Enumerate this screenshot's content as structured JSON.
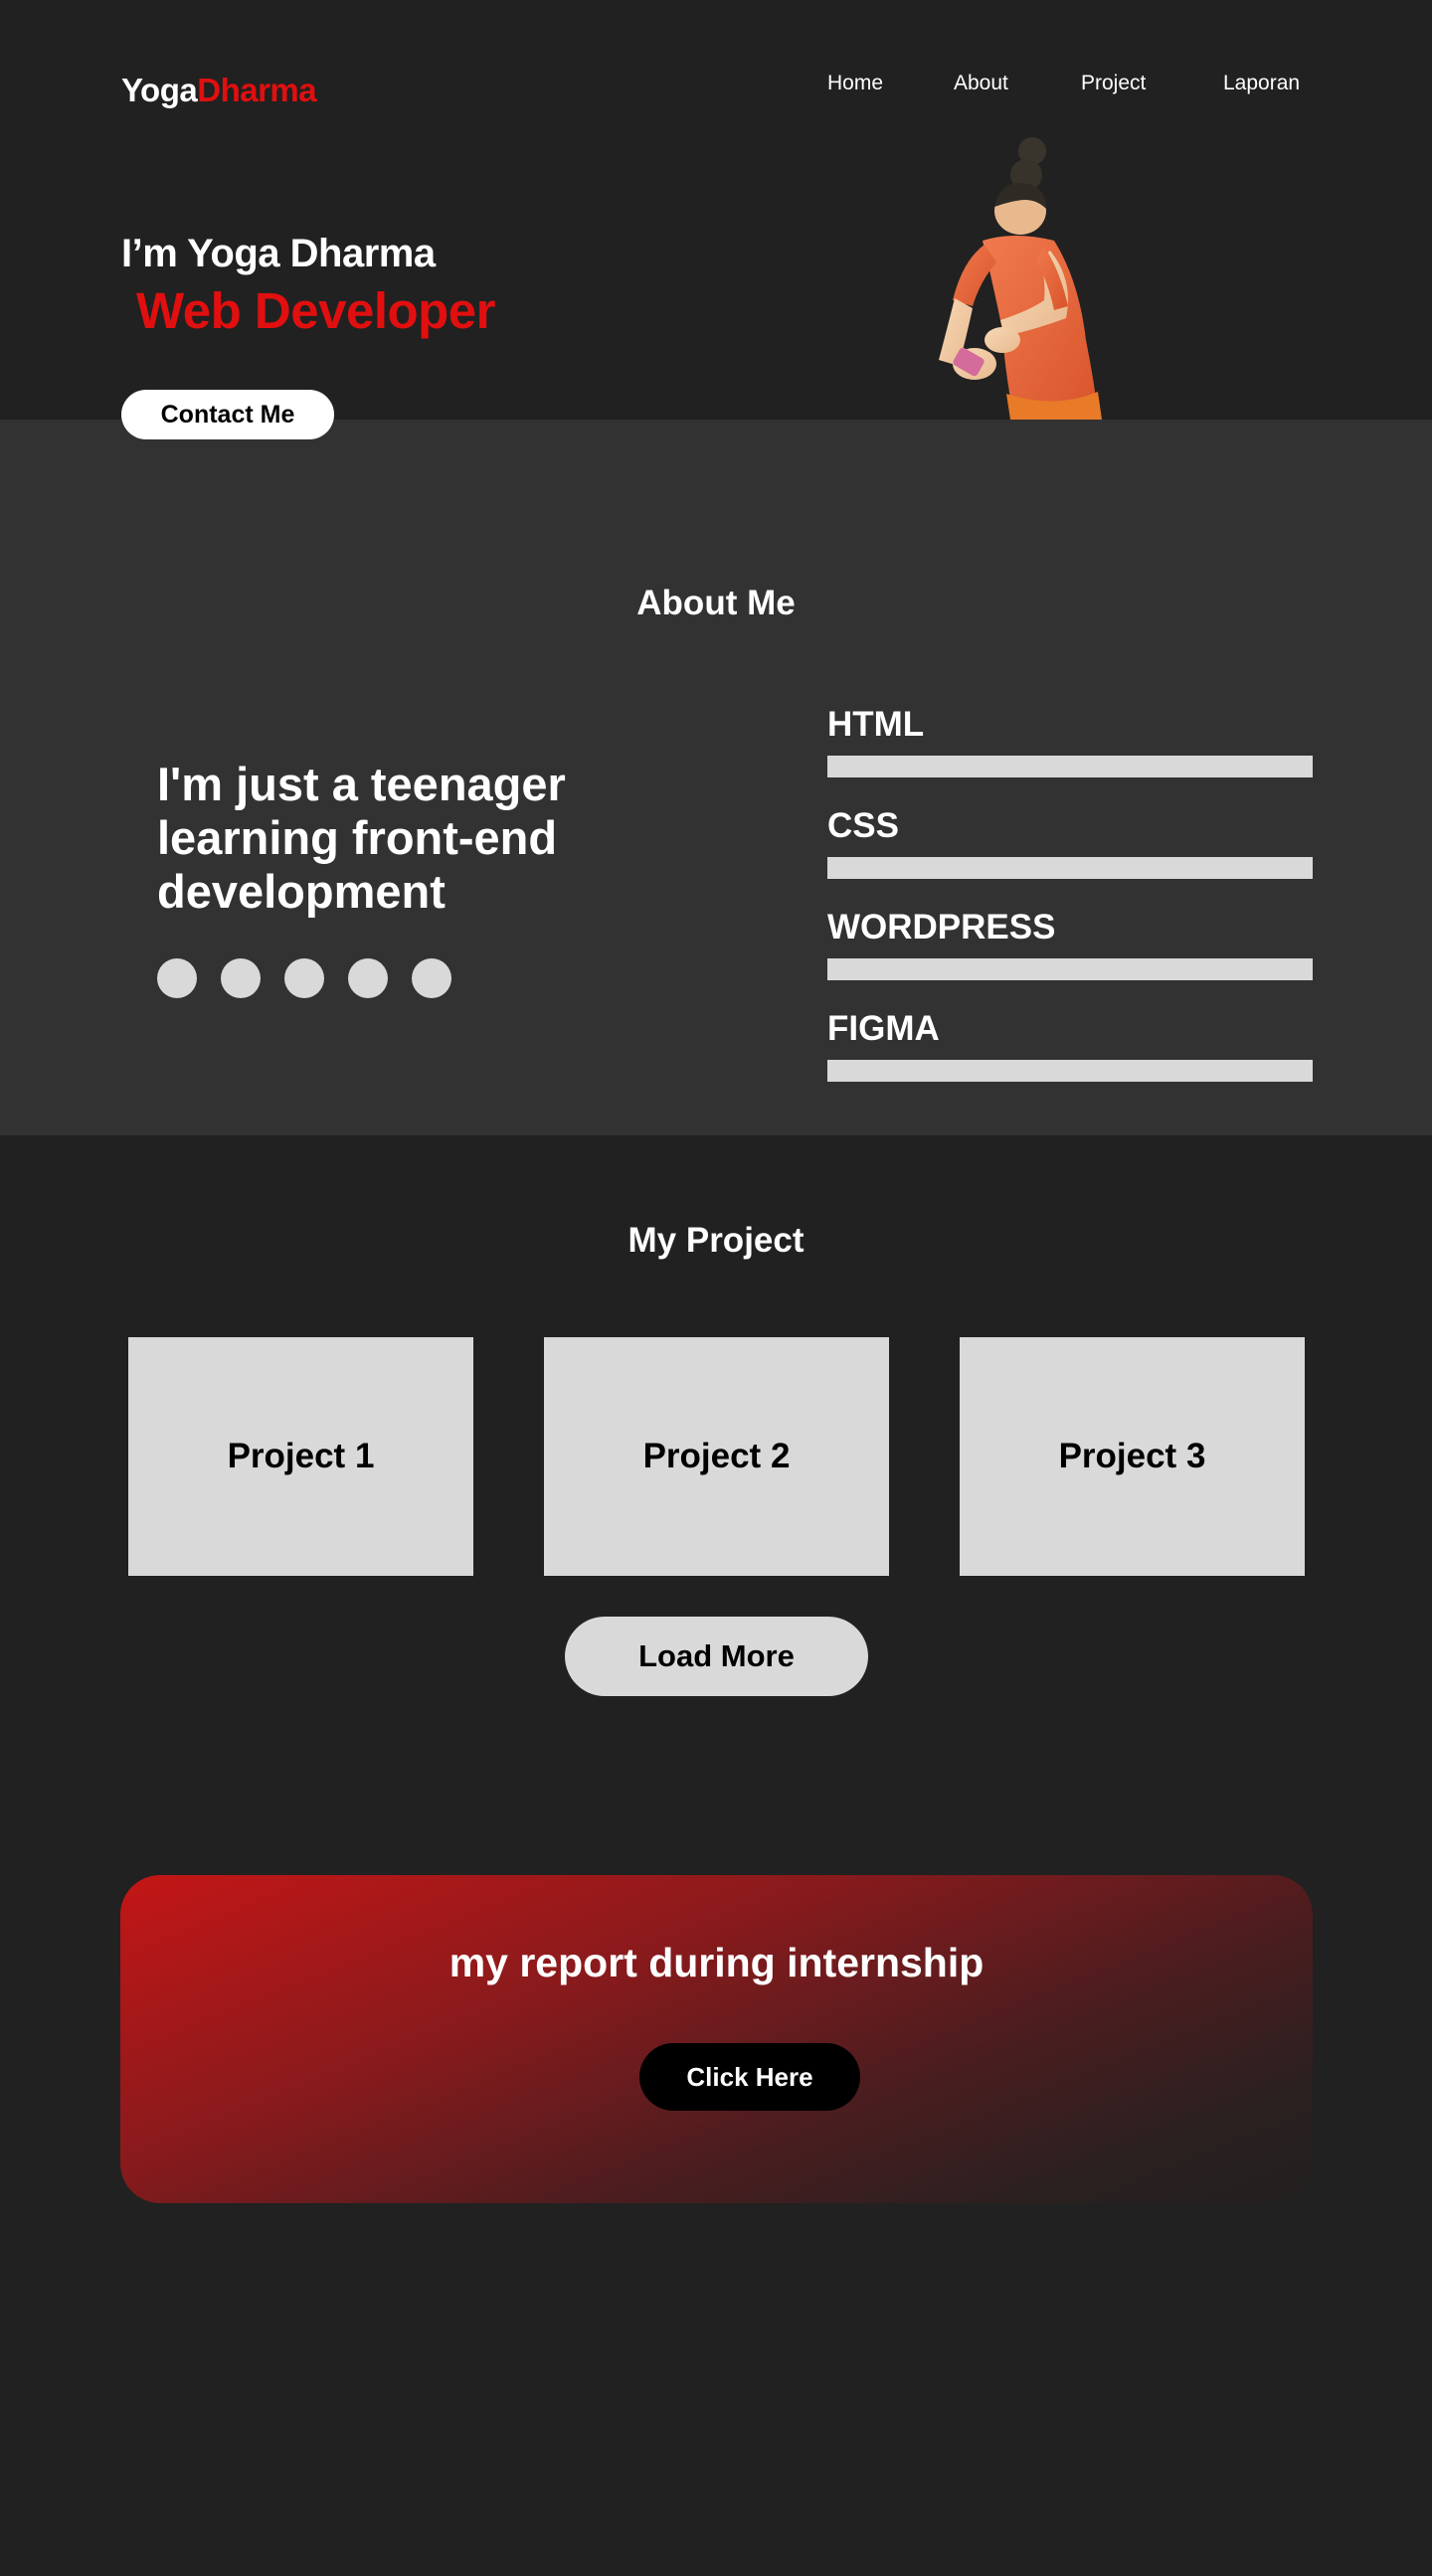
{
  "header": {
    "logo_first": "Yoga",
    "logo_second": "Dharma",
    "nav": [
      "Home",
      "About",
      "Project",
      "Laporan"
    ]
  },
  "hero": {
    "greeting": "I’m Yoga Dharma",
    "role": "Web Developer",
    "contact_label": "Contact Me",
    "illustration": "person-with-phone-illustration"
  },
  "about": {
    "title": "About Me",
    "tagline": "I'm just a teenager learning front-end development",
    "social_icons": [
      "social-icon-1",
      "social-icon-2",
      "social-icon-3",
      "social-icon-4",
      "social-icon-5"
    ],
    "skills": [
      {
        "name": "HTML",
        "level": 1.0
      },
      {
        "name": "CSS",
        "level": 1.0
      },
      {
        "name": "WORDPRESS",
        "level": 1.0
      },
      {
        "name": "FIGMA",
        "level": 1.0
      }
    ]
  },
  "projects": {
    "title": "My Project",
    "items": [
      "Project 1",
      "Project 2",
      "Project 3"
    ],
    "load_more_label": "Load More"
  },
  "report": {
    "title": "my report during internship",
    "button_label": "Click Here"
  },
  "colors": {
    "accent": "#e10f0f",
    "background": "#212121",
    "section_alt": "#323232",
    "placeholder": "#d9d9d9"
  }
}
